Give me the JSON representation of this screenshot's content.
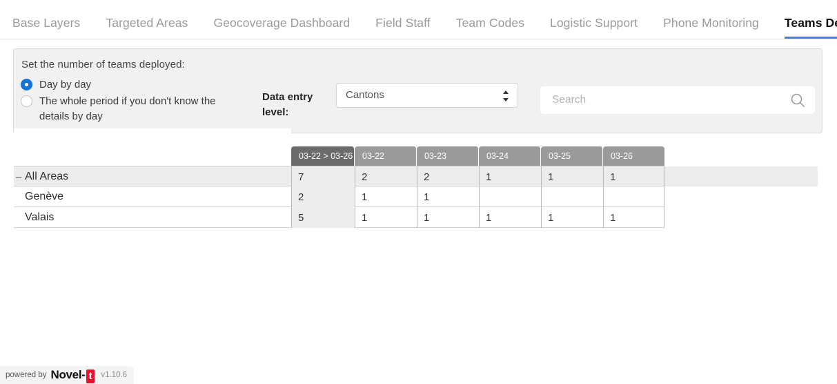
{
  "tabs": [
    {
      "label": "Base Layers",
      "active": false
    },
    {
      "label": "Targeted Areas",
      "active": false
    },
    {
      "label": "Geocoverage Dashboard",
      "active": false
    },
    {
      "label": "Field Staff",
      "active": false
    },
    {
      "label": "Team Codes",
      "active": false
    },
    {
      "label": "Logistic Support",
      "active": false
    },
    {
      "label": "Phone Monitoring",
      "active": false
    },
    {
      "label": "Teams Deployment",
      "active": true
    }
  ],
  "panel": {
    "heading": "Set the number of teams deployed:",
    "options": [
      {
        "label": "Day by day",
        "checked": true
      },
      {
        "label": "The whole period if you don't know the details by day",
        "checked": false
      }
    ],
    "data_entry_label": "Data entry level:",
    "level_select": {
      "value": "Cantons",
      "options": [
        "Cantons"
      ],
      "icon": "chevron-up-down-icon"
    },
    "search": {
      "value": "",
      "placeholder": "Search",
      "icon": "search-icon"
    }
  },
  "table": {
    "columns": [
      {
        "label": "03-22 > 03-26",
        "type": "total"
      },
      {
        "label": "03-22",
        "type": "day"
      },
      {
        "label": "03-23",
        "type": "day"
      },
      {
        "label": "03-24",
        "type": "day"
      },
      {
        "label": "03-25",
        "type": "day"
      },
      {
        "label": "03-26",
        "type": "day"
      }
    ],
    "rows": [
      {
        "name": "All Areas",
        "level": "summary",
        "toggle": "–",
        "toggle_icon": "collapse-minus-icon",
        "values": [
          "7",
          "2",
          "2",
          "1",
          "1",
          "1"
        ]
      },
      {
        "name": "Genève",
        "level": "child",
        "toggle": "",
        "values": [
          "2",
          "1",
          "1",
          "",
          "",
          ""
        ]
      },
      {
        "name": "Valais",
        "level": "child",
        "toggle": "",
        "values": [
          "5",
          "1",
          "1",
          "1",
          "1",
          "1"
        ]
      }
    ]
  },
  "footer": {
    "powered_by": "powered by",
    "brand": "Novel-",
    "brand_mark": "t",
    "version": "v1.10.6"
  },
  "colors": {
    "accent": "#4a7fd4",
    "radio_selected": "#1573d6",
    "header_total": "#6b6b6b",
    "header_day": "#9a9a9a",
    "row_highlight": "#ececec",
    "brand_red": "#e8112d"
  }
}
